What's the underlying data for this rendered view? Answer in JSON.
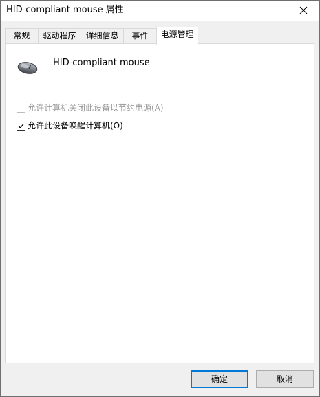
{
  "window": {
    "title": "HID-compliant mouse 属性",
    "close_icon": "close-icon"
  },
  "tabs": [
    {
      "label": "常规",
      "active": false
    },
    {
      "label": "驱动程序",
      "active": false
    },
    {
      "label": "详细信息",
      "active": false
    },
    {
      "label": "事件",
      "active": false
    },
    {
      "label": "电源管理",
      "active": true
    }
  ],
  "device": {
    "icon": "mouse-icon",
    "name": "HID-compliant mouse"
  },
  "options": [
    {
      "label": "允许计算机关闭此设备以节约电源(A)",
      "checked": false,
      "enabled": false
    },
    {
      "label": "允许此设备唤醒计算机(O)",
      "checked": true,
      "enabled": true
    }
  ],
  "buttons": {
    "ok": "确定",
    "cancel": "取消"
  },
  "colors": {
    "accent": "#0078d7",
    "disabled_text": "#9a9a9a"
  }
}
